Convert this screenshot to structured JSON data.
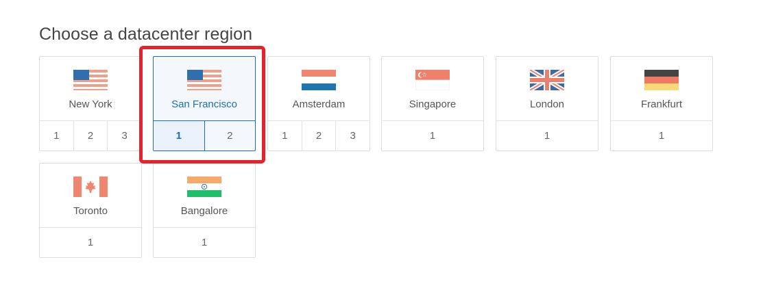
{
  "heading": "Choose a datacenter region",
  "colors": {
    "selected": "#1a6fb5",
    "highlight": "#e8222a"
  },
  "regions": [
    {
      "city": "New York",
      "flag": "us-flag-icon",
      "numbers": [
        "1",
        "2",
        "3"
      ]
    },
    {
      "city": "San Francisco",
      "flag": "us-flag-icon",
      "numbers": [
        "1",
        "2"
      ],
      "selected": true,
      "active_number": "1"
    },
    {
      "city": "Amsterdam",
      "flag": "netherlands-flag-icon",
      "numbers": [
        "1",
        "2",
        "3"
      ]
    },
    {
      "city": "Singapore",
      "flag": "singapore-flag-icon",
      "numbers": [
        "1"
      ]
    },
    {
      "city": "London",
      "flag": "uk-flag-icon",
      "numbers": [
        "1"
      ]
    },
    {
      "city": "Frankfurt",
      "flag": "germany-flag-icon",
      "numbers": [
        "1"
      ]
    },
    {
      "city": "Toronto",
      "flag": "canada-flag-icon",
      "numbers": [
        "1"
      ]
    },
    {
      "city": "Bangalore",
      "flag": "india-flag-icon",
      "numbers": [
        "1"
      ]
    }
  ]
}
